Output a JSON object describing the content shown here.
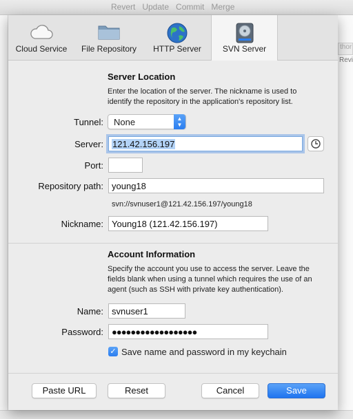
{
  "background": {
    "menu": [
      "Revert",
      "Update",
      "Commit",
      "Merge"
    ],
    "right_header": "thor",
    "right_cell": "Revis"
  },
  "tabs": [
    {
      "label": "Cloud Service",
      "icon": "cloud-icon"
    },
    {
      "label": "File Repository",
      "icon": "folder-icon"
    },
    {
      "label": "HTTP Server",
      "icon": "globe-icon"
    },
    {
      "label": "SVN Server",
      "icon": "hard-drive-icon",
      "active": true
    }
  ],
  "server_location": {
    "title": "Server Location",
    "description": "Enter the location of the server. The nickname is used to identify the repository in the application's repository list.",
    "tunnel_label": "Tunnel:",
    "tunnel_value": "None",
    "server_label": "Server:",
    "server_value": "121.42.156.197",
    "port_label": "Port:",
    "port_value": "",
    "repo_path_label": "Repository path:",
    "repo_path_value": "young18",
    "url_preview": "svn://svnuser1@121.42.156.197/young18",
    "nickname_label": "Nickname:",
    "nickname_value": "Young18 (121.42.156.197)"
  },
  "account": {
    "title": "Account Information",
    "description": "Specify the account you use to access the server. Leave the fields blank when using a tunnel which requires the use of an agent (such as SSH with private key authentication).",
    "name_label": "Name:",
    "name_value": "svnuser1",
    "password_label": "Password:",
    "password_value": "●●●●●●●●●●●●●●●●●●",
    "keychain_label": "Save name and password in my keychain",
    "keychain_checked": true
  },
  "footer": {
    "paste_url": "Paste URL",
    "reset": "Reset",
    "cancel": "Cancel",
    "save": "Save"
  },
  "colors": {
    "accent": "#2b7ef0",
    "selection": "#b3d3f7"
  }
}
